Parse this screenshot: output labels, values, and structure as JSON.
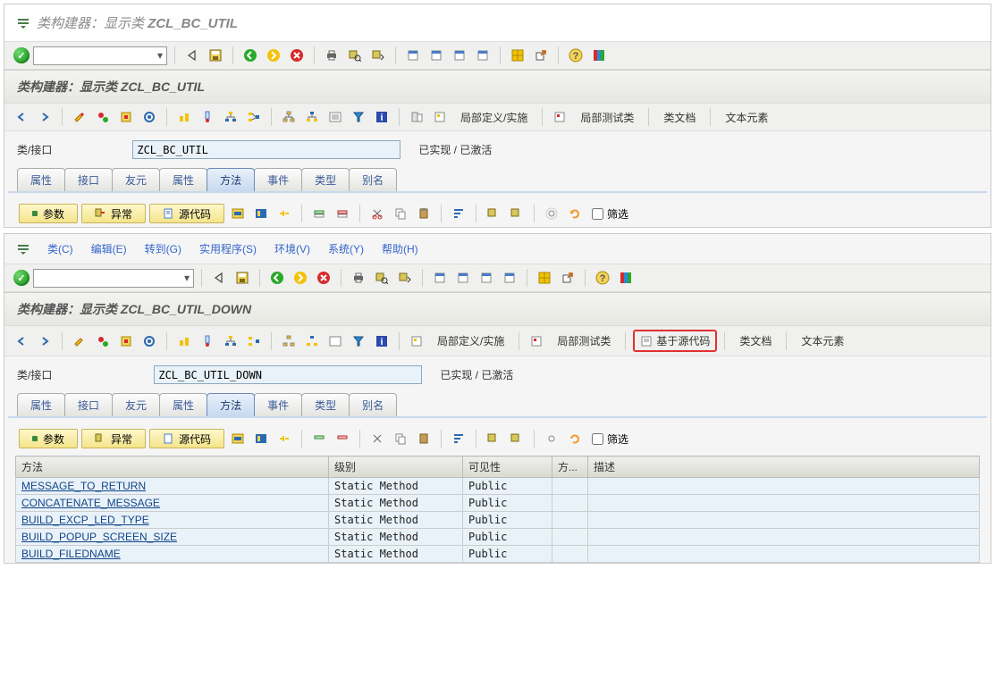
{
  "top": {
    "window_title_prefix": "类构建器：显示类 ",
    "window_title_class": "ZCL_BC_UTIL",
    "sub_title_prefix": "类构建器：显示类 ",
    "sub_title_class": "ZCL_BC_UTIL",
    "class_iface_label": "类/接口",
    "class_name": "ZCL_BC_UTIL",
    "status": "已实现 / 已激活",
    "tabs": [
      "属性",
      "接口",
      "友元",
      "属性",
      "方法",
      "事件",
      "类型",
      "别名"
    ],
    "active_tab_index": 4,
    "links": {
      "local_def": "局部定义/实施",
      "local_test": "局部测试类",
      "class_doc": "类文档",
      "text_elem": "文本元素"
    },
    "inner_buttons": {
      "params": "参数",
      "exceptions": "异常",
      "source": "源代码"
    },
    "filter_label": "筛选"
  },
  "bottom": {
    "menu": {
      "class": "类(C)",
      "edit": "编辑(E)",
      "goto": "转到(G)",
      "util": "实用程序(S)",
      "env": "环境(V)",
      "system": "系统(Y)",
      "help": "帮助(H)"
    },
    "sub_title_prefix": "类构建器：显示类 ",
    "sub_title_class": "ZCL_BC_UTIL_DOWN",
    "class_iface_label": "类/接口",
    "class_name": "ZCL_BC_UTIL_DOWN",
    "status": "已实现 / 已激活",
    "tabs": [
      "属性",
      "接口",
      "友元",
      "属性",
      "方法",
      "事件",
      "类型",
      "别名"
    ],
    "active_tab_index": 4,
    "links": {
      "local_def": "局部定义/实施",
      "local_test": "局部测试类",
      "source_based": "基于源代码",
      "class_doc": "类文档",
      "text_elem": "文本元素"
    },
    "inner_buttons": {
      "params": "参数",
      "exceptions": "异常",
      "source": "源代码"
    },
    "filter_label": "筛选",
    "table": {
      "headers": {
        "method": "方法",
        "level": "级别",
        "visibility": "可见性",
        "m": "方...",
        "desc": "描述"
      },
      "rows": [
        {
          "method": "MESSAGE_TO_RETURN",
          "level": "Static Method",
          "visibility": "Public"
        },
        {
          "method": "CONCATENATE_MESSAGE",
          "level": "Static Method",
          "visibility": "Public"
        },
        {
          "method": "BUILD_EXCP_LED_TYPE",
          "level": "Static Method",
          "visibility": "Public"
        },
        {
          "method": "BUILD_POPUP_SCREEN_SIZE",
          "level": "Static Method",
          "visibility": "Public"
        },
        {
          "method": "BUILD_FILEDNAME",
          "level": "Static Method",
          "visibility": "Public"
        }
      ]
    }
  },
  "icons": {
    "tri": "◁",
    "save": "💾",
    "back_g": "↺",
    "exit_y": "↻",
    "cancel_r": "✖",
    "print": "🖨",
    "find": "🔍",
    "findn": "🔎",
    "new1": "📄",
    "new2": "📄",
    "new3": "📄",
    "new4": "📄",
    "grid": "▦",
    "popout": "↗",
    "help": "?",
    "col": "▥"
  }
}
